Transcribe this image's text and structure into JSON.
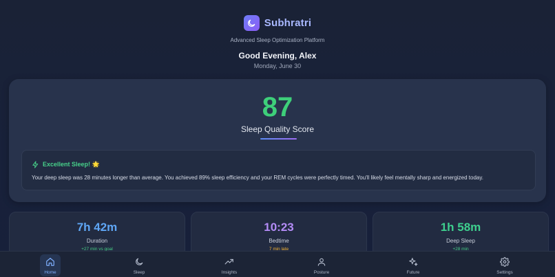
{
  "app": {
    "name": "Subhratri",
    "tagline": "Advanced Sleep Optimization Platform"
  },
  "header": {
    "greeting": "Good Evening, Alex",
    "date": "Monday, June 30"
  },
  "score": {
    "value": "87",
    "label": "Sleep Quality Score"
  },
  "insight": {
    "title": "Excellent Sleep! 🌟",
    "text": "Your deep sleep was 28 minutes longer than average. You achieved 89% sleep efficiency and your REM cycles were perfectly timed. You'll likely feel mentally sharp and energized today."
  },
  "stats": [
    {
      "value": "7h 42m",
      "label": "Duration",
      "sub": "+27 min vs goal",
      "value_color": "#5fa6f5",
      "sub_color": "#46cf86"
    },
    {
      "value": "10:23",
      "label": "Bedtime",
      "sub": "7 min late",
      "value_color": "#b48cf7",
      "sub_color": "#f2b233"
    },
    {
      "value": "1h 58m",
      "label": "Deep Sleep",
      "sub": "+28 min",
      "value_color": "#3ecf8e",
      "sub_color": "#46cf86"
    }
  ],
  "nav": [
    {
      "label": "Home",
      "icon": "home-icon",
      "active": true
    },
    {
      "label": "Sleep",
      "icon": "moon-icon",
      "active": false
    },
    {
      "label": "Insights",
      "icon": "trend-icon",
      "active": false
    },
    {
      "label": "Posture",
      "icon": "user-icon",
      "active": false
    },
    {
      "label": "Future",
      "icon": "sparkles-icon",
      "active": false
    },
    {
      "label": "Settings",
      "icon": "gear-icon",
      "active": false
    }
  ],
  "colors": {
    "accent": "#6f7df7",
    "score": "#3ecf7a",
    "insight_title": "#47d18a"
  }
}
